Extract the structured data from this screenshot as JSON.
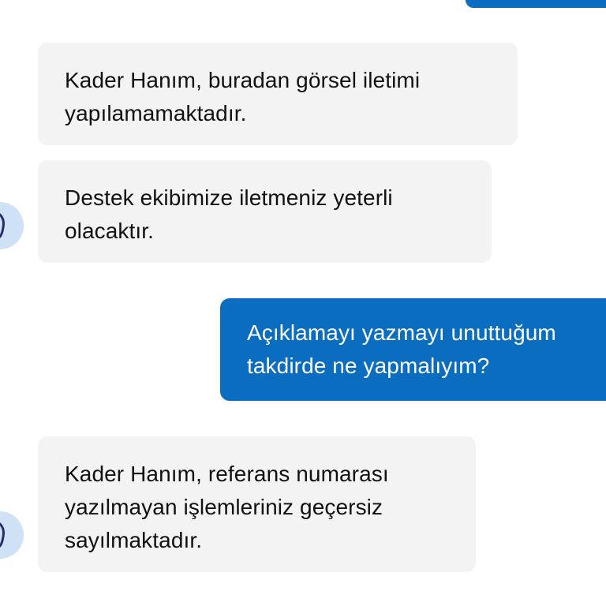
{
  "colors": {
    "incoming_bubble": "#f3f3f3",
    "outgoing_bubble": "#0a6dbf",
    "incoming_text": "#111111",
    "outgoing_text": "#ffffff",
    "avatar_bg": "#cfe1f5"
  },
  "messages": [
    {
      "direction": "incoming",
      "lines": [
        "Kader Hanım, buradan görsel iletimi",
        "yapılamamaktadır."
      ]
    },
    {
      "direction": "incoming",
      "lines": [
        "Destek ekibimize iletmeniz yeterli",
        "olacaktır."
      ],
      "avatar": "agent-avatar-icon"
    },
    {
      "direction": "outgoing",
      "lines": [
        "Açıklamayı yazmayı unuttuğum",
        "takdirde ne yapmalıyım?"
      ]
    },
    {
      "direction": "incoming",
      "lines": [
        "Kader Hanım, referans numarası",
        "yazılmayan işlemleriniz geçersiz",
        "sayılmaktadır."
      ],
      "avatar": "agent-avatar-icon"
    }
  ]
}
